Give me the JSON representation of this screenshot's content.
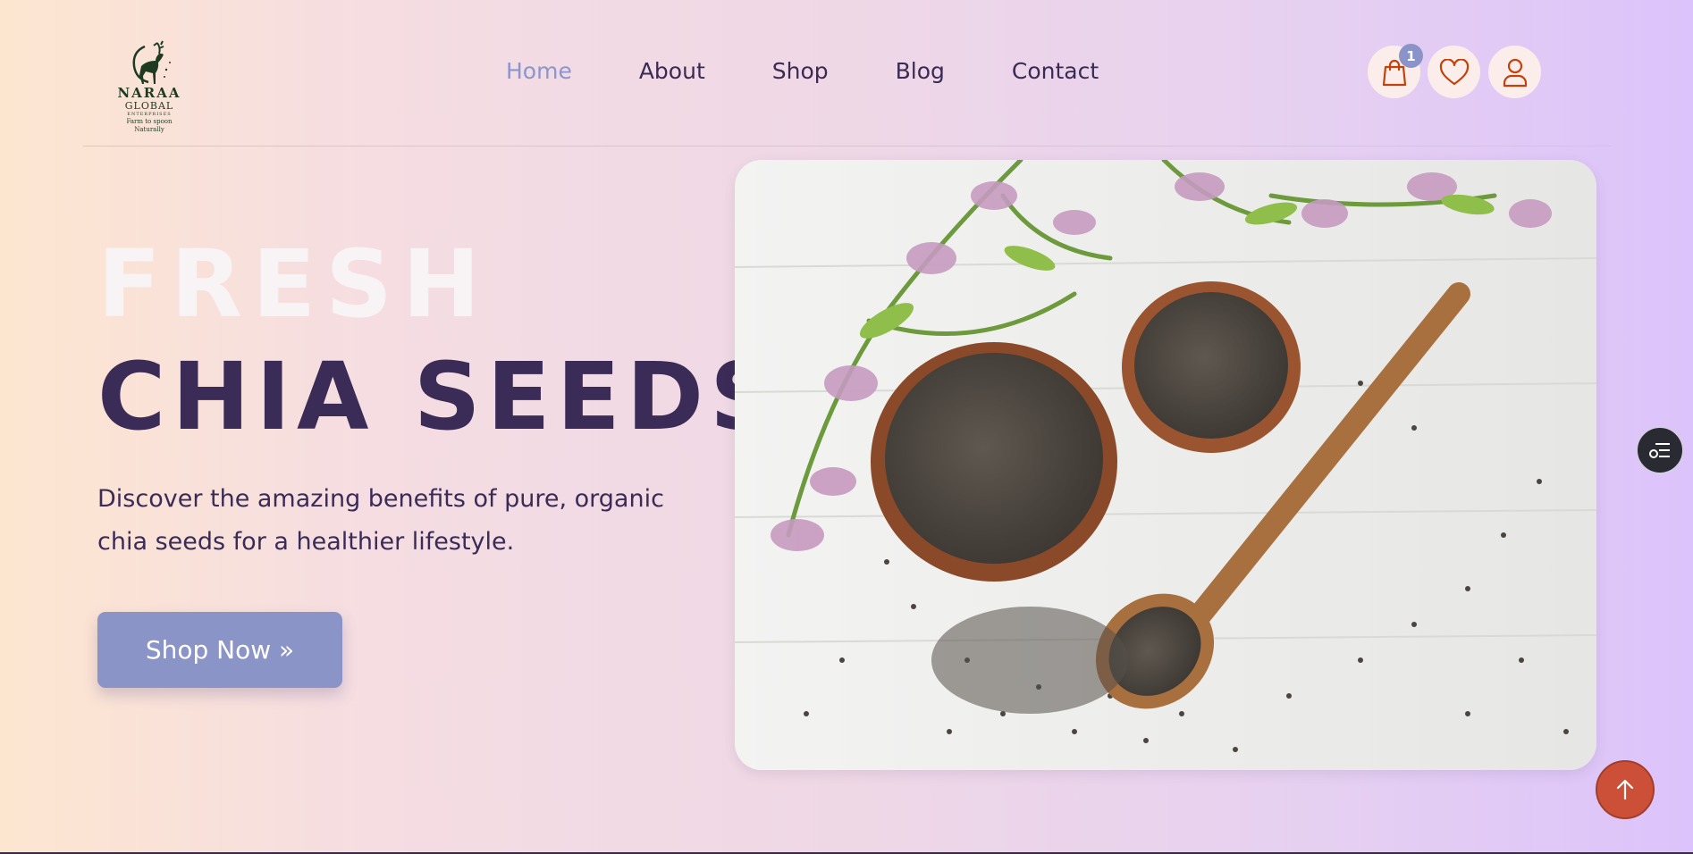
{
  "logo": {
    "brand": "NARAA",
    "sub": "GLOBAL",
    "sub2": "ENTERPRISES",
    "tagline": "Farm to spoon Naturally",
    "icon": "deer-icon"
  },
  "nav": {
    "items": [
      {
        "label": "Home",
        "active": true
      },
      {
        "label": "About"
      },
      {
        "label": "Shop"
      },
      {
        "label": "Blog"
      },
      {
        "label": "Contact"
      }
    ]
  },
  "header_icons": {
    "cart": {
      "icon": "shopping-bag-icon",
      "badge": "1"
    },
    "wishlist": {
      "icon": "heart-icon"
    },
    "account": {
      "icon": "user-icon"
    }
  },
  "hero": {
    "title_line1": "FRESH",
    "title_line2": "CHIA SEEDS",
    "description": "Discover the amazing benefits of pure, organic chia seeds for a healthier lifestyle.",
    "cta_label": "Shop Now »"
  },
  "floating": {
    "menu_icon": "list-menu-icon",
    "scroll_top_icon": "arrow-up-icon"
  },
  "colors": {
    "accent": "#8a96cc",
    "heading": "#3b2b57",
    "icon_stroke": "#c2410c",
    "scroll_button": "#cc5038"
  }
}
